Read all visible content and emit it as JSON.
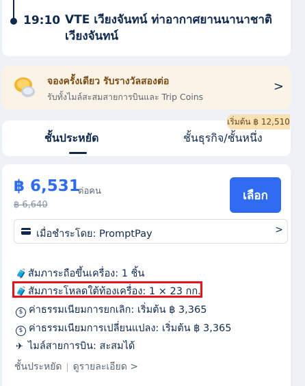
{
  "flight": {
    "time": "19:10",
    "destination": "VTE เวียงจันทน์ ท่าอากาศยานนานาชาติเวียงจันทน์"
  },
  "promo": {
    "title": "จองครั้งเดียว รับรางวัลสองต่อ",
    "subtitle": "รับทั้งไมล์สะสมสายการบินและ Trip Coins",
    "chevron": ">"
  },
  "badge": {
    "from_price": "เริ่มต้น ฿ 12,510"
  },
  "tabs": [
    {
      "label": "ชั้นประหยัด"
    },
    {
      "label": "ชั้นธุรกิจ/ชั้นหนึ่ง"
    }
  ],
  "fare": {
    "price": "฿ 6,531",
    "per_person": "ต่อคน",
    "old_price": "฿ 6,640",
    "select_label": "เลือก",
    "payment": "เมื่อชำระโดย: PromptPay",
    "payment_chevron": ">",
    "features": [
      "สัมภาระถือขึ้นเครื่อง: 1 ชิ้น",
      "สัมภาระโหลดใต้ท้องเครื่อง: 1 × 23 กก.",
      "ค่าธรรมเนียมการยกเลิก: เริ่มต้น ฿ 3,365",
      "ค่าธรรมเนียมการเปลี่ยนแปลง: เริ่มต้น ฿ 3,365",
      "ไมล์สายการบิน: สะสมได้"
    ],
    "class_name": "ชั้นประหยัด",
    "details_link": "ดูรายละเอียด >"
  },
  "colors": {
    "accent": "#2e6bf0",
    "highlight": "#e8141b",
    "navy": "#0f294d"
  }
}
